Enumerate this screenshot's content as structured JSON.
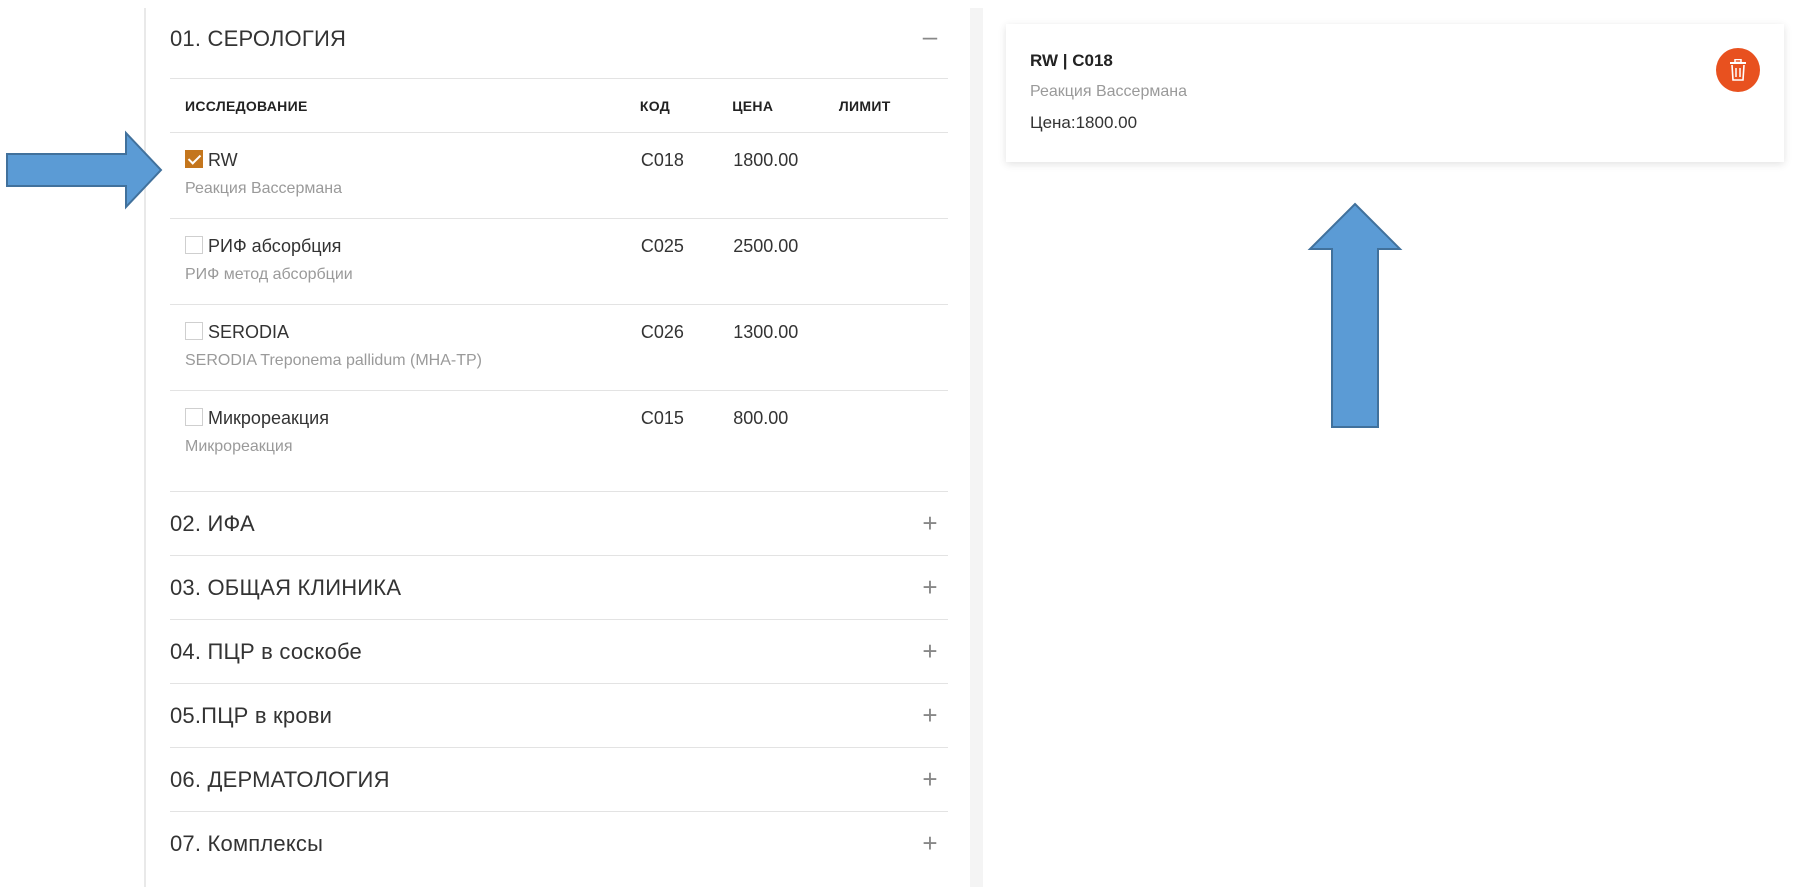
{
  "colors": {
    "accent": "#c4761d",
    "delete": "#e8511f",
    "arrow": "#5b9bd5"
  },
  "open_section": {
    "title": "01. СЕРОЛОГИЯ",
    "toggle_icon": "minus-icon",
    "columns": {
      "name": "ИССЛЕДОВАНИЕ",
      "code": "КОД",
      "price": "ЦЕНА",
      "limit": "ЛИМИТ"
    },
    "rows": [
      {
        "name": "RW",
        "desc": "Реакция Вассермана",
        "code": "C018",
        "price": "1800.00",
        "limit": "",
        "checked": true
      },
      {
        "name": "РИФ абсорбция",
        "desc": "РИФ метод абсорбции",
        "code": "C025",
        "price": "2500.00",
        "limit": "",
        "checked": false
      },
      {
        "name": "SERODIA",
        "desc": "SERODIA Treponema pallidum (MHA-TP)",
        "code": "C026",
        "price": "1300.00",
        "limit": "",
        "checked": false
      },
      {
        "name": "Микрореакция",
        "desc": "Микрореакция",
        "code": "C015",
        "price": "800.00",
        "limit": "",
        "checked": false
      }
    ]
  },
  "collapsed_sections": [
    {
      "title": "02. ИФА",
      "toggle_icon": "plus-icon"
    },
    {
      "title": "03. ОБЩАЯ КЛИНИКА",
      "toggle_icon": "plus-icon"
    },
    {
      "title": "04. ПЦР в соскобе",
      "toggle_icon": "plus-icon"
    },
    {
      "title": "05.ПЦР в крови",
      "toggle_icon": "plus-icon"
    },
    {
      "title": "06. ДЕРМАТОЛОГИЯ",
      "toggle_icon": "plus-icon"
    },
    {
      "title": "07. Комплексы",
      "toggle_icon": "plus-icon"
    }
  ],
  "selected_card": {
    "title": "RW | C018",
    "desc": "Реакция Вассермана",
    "price": "Цена:1800.00",
    "delete_icon": "trash-icon"
  }
}
